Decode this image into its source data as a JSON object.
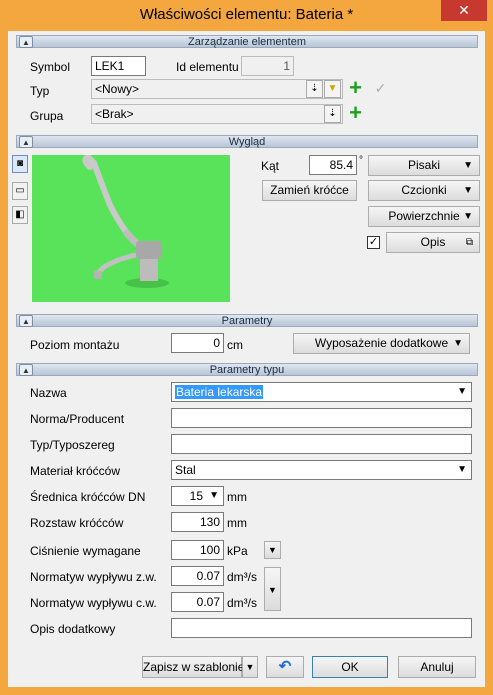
{
  "window": {
    "title": "Właściwości elementu: Bateria *"
  },
  "sections": {
    "management": "Zarządzanie elementem",
    "appearance": "Wygląd",
    "parameters": "Parametry",
    "type_parameters": "Parametry typu"
  },
  "management": {
    "symbol_label": "Symbol",
    "symbol_value": "LEK1",
    "id_label": "Id elementu",
    "id_value": "1",
    "type_label": "Typ",
    "type_value": "<Nowy>",
    "group_label": "Grupa",
    "group_value": "<Brak>"
  },
  "appearance": {
    "angle_label": "Kąt",
    "angle_value": "85.4",
    "angle_unit": "°",
    "pens_button": "Pisaki",
    "swap_button": "Zamień króćce",
    "fonts_button": "Czcionki",
    "surfaces_button": "Powierzchnie",
    "description_button": "Opis",
    "description_checked": true
  },
  "parameters": {
    "mount_level_label": "Poziom montażu",
    "mount_level_value": "0",
    "mount_level_unit": "cm",
    "equipment_button": "Wyposażenie dodatkowe"
  },
  "type_params": {
    "name_label": "Nazwa",
    "name_value": "Bateria lekarska",
    "norm_label": "Norma/Producent",
    "norm_value": "",
    "series_label": "Typ/Typoszereg",
    "series_value": "",
    "material_label": "Materiał króćców",
    "material_value": "Stal",
    "diameter_label": "Średnica króćców DN",
    "diameter_value": "15",
    "diameter_unit": "mm",
    "spacing_label": "Rozstaw króćców",
    "spacing_value": "130",
    "spacing_unit": "mm",
    "pressure_label": "Ciśnienie wymagane",
    "pressure_value": "100",
    "pressure_unit": "kPa",
    "flow_cold_label": "Normatyw wypływu z.w.",
    "flow_cold_value": "0.07",
    "flow_cold_unit": "dm³/s",
    "flow_hot_label": "Normatyw wypływu c.w.",
    "flow_hot_value": "0.07",
    "flow_hot_unit": "dm³/s",
    "extra_label": "Opis dodatkowy",
    "extra_value": ""
  },
  "footer": {
    "save_template": "Zapisz w szablonie",
    "ok": "OK",
    "cancel": "Anuluj"
  },
  "colors": {
    "title_bar": "#f4a63f",
    "close_button": "#c7392f",
    "preview_bg": "#59e35a",
    "selection": "#3399ff"
  },
  "icons": {
    "close": "close-icon",
    "collapse": "chevron-up-icon",
    "add": "plus-icon",
    "confirm": "checkmark-icon",
    "undo": "undo-icon"
  }
}
